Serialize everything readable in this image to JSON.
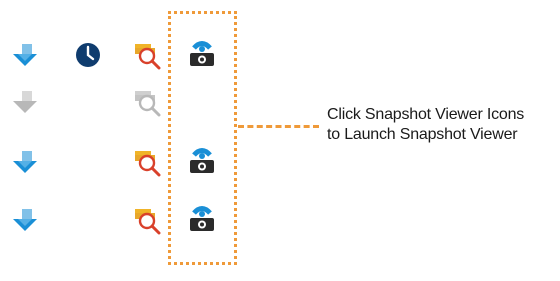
{
  "callout": {
    "line1": "Click Snapshot Viewer Icons",
    "line2": "to Launch Snapshot Viewer"
  },
  "colors": {
    "accent_blue": "#1a8fd6",
    "disabled_gray": "#b8b8b8",
    "clock_navy": "#0f3c6e",
    "folder_gold": "#f0b429",
    "lens_red": "#d9412b",
    "camera_dark": "#2b2b2b",
    "highlight_orange": "#ef9a39"
  },
  "rows": [
    {
      "icons": [
        "share-icon",
        "clock-icon",
        "folder-search-icon",
        "snapshot-viewer-icon"
      ],
      "enabled": true
    },
    {
      "icons": [
        "share-icon",
        "folder-search-icon"
      ],
      "enabled": false
    },
    {
      "icons": [
        "share-icon",
        "folder-search-icon",
        "snapshot-viewer-icon"
      ],
      "enabled": true
    },
    {
      "icons": [
        "share-icon",
        "folder-search-icon",
        "snapshot-viewer-icon"
      ],
      "enabled": true
    }
  ]
}
